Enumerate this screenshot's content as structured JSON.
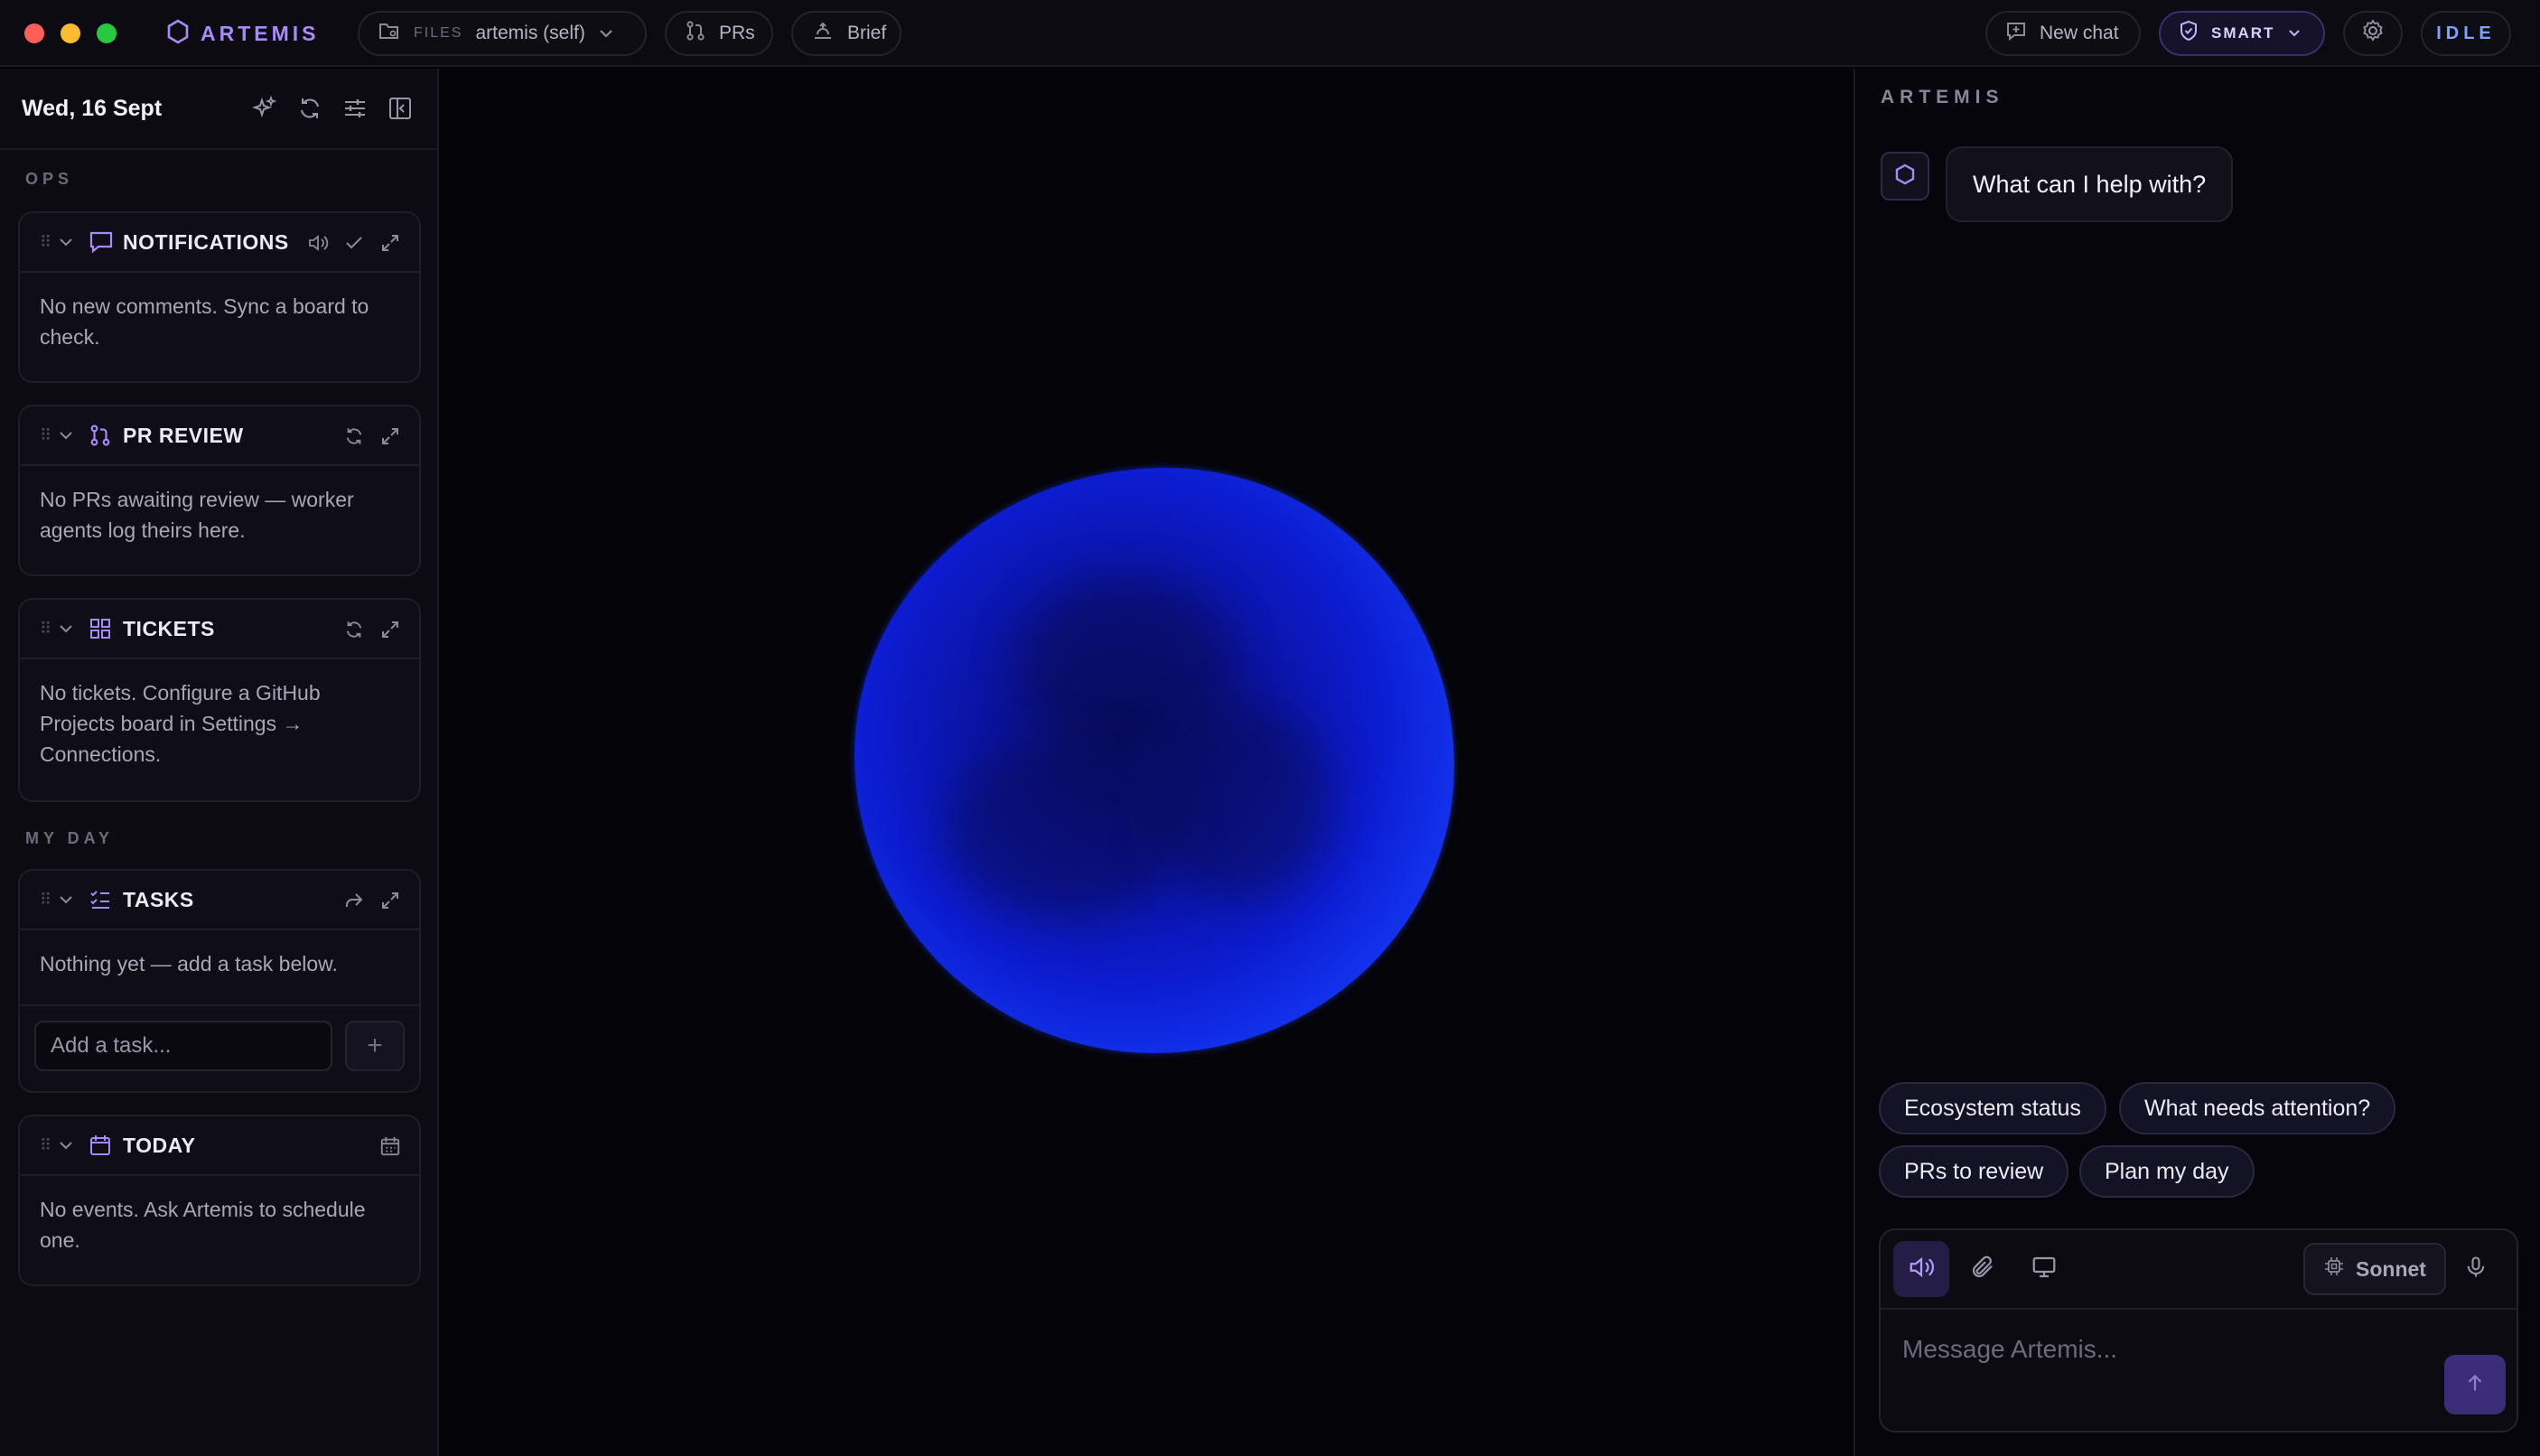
{
  "titlebar": {
    "app_name": "ARTEMIS",
    "files_label": "FILES",
    "files_value": "artemis (self)",
    "prs_label": "PRs",
    "brief_label": "Brief",
    "new_chat_label": "New chat",
    "mode_label": "SMART",
    "status_label": "IDLE"
  },
  "sidebar": {
    "date": "Wed, 16 Sept",
    "sections": {
      "ops": "OPS",
      "my_day": "MY DAY"
    },
    "notifications": {
      "title": "NOTIFICATIONS",
      "body": "No new comments. Sync a board to check."
    },
    "pr_review": {
      "title": "PR REVIEW",
      "body": "No PRs awaiting review — worker agents log theirs here."
    },
    "tickets": {
      "title": "TICKETS",
      "body": "No tickets. Configure a GitHub Projects board in Settings → Connections."
    },
    "tasks": {
      "title": "TASKS",
      "body": "Nothing yet — add a task below.",
      "input_placeholder": "Add a task...",
      "add_label": "+"
    },
    "today": {
      "title": "TODAY",
      "body": "No events. Ask Artemis to schedule one."
    }
  },
  "chat": {
    "title": "ARTEMIS",
    "greeting": "What can I help with?",
    "suggestions": [
      "Ecosystem status",
      "What needs attention?",
      "PRs to review",
      "Plan my day"
    ],
    "model_label": "Sonnet",
    "input_placeholder": "Message Artemis..."
  },
  "colors": {
    "accent": "#a78bfa",
    "orb_blue": "#1b45ff",
    "background": "#050409",
    "idle_status": "#7fa3ff"
  }
}
